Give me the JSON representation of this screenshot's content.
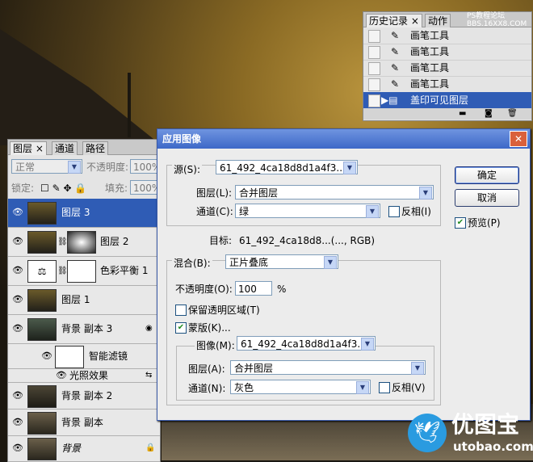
{
  "watermark_top": "PS教程论坛\nBBS.16XX8.COM",
  "history_panel": {
    "tabs": [
      "历史记录",
      "动作"
    ],
    "items": [
      "画笔工具",
      "画笔工具",
      "画笔工具",
      "画笔工具",
      "盖印可见图层"
    ]
  },
  "layers_panel": {
    "tabs": [
      "图层",
      "通道",
      "路径"
    ],
    "blend_mode": "正常",
    "opacity_label": "不透明度:",
    "opacity_value": "100%",
    "lock_label": "锁定:",
    "fill_label": "填充:",
    "fill_value": "100%",
    "layers": [
      {
        "name": "图层 3"
      },
      {
        "name": "图层 2"
      },
      {
        "name": "色彩平衡 1"
      },
      {
        "name": "图层 1"
      },
      {
        "name": "背景 副本 3"
      },
      {
        "name": "智能滤镜"
      },
      {
        "name": "光照效果"
      },
      {
        "name": "背景 副本 2"
      },
      {
        "name": "背景 副本"
      },
      {
        "name": "背景"
      }
    ]
  },
  "dialog": {
    "title": "应用图像",
    "source_label": "源(S):",
    "source_value": "61_492_4ca18d8d1a4f3...",
    "layer_label": "图层(L):",
    "layer_value": "合并图层",
    "channel_label": "通道(C):",
    "channel_value": "绿",
    "invert1_label": "反相(I)",
    "target_label": "目标:",
    "target_value": "61_492_4ca18d8...(..., RGB)",
    "blend_label": "混合(B):",
    "blend_value": "正片叠底",
    "opacity_label": "不透明度(O):",
    "opacity_value": "100",
    "opacity_unit": "%",
    "preserve_label": "保留透明区域(T)",
    "mask_label": "蒙版(K)...",
    "image_label": "图像(M):",
    "image_value": "61_492_4ca18d8d1a4f3...",
    "mask_layer_label": "图层(A):",
    "mask_layer_value": "合并图层",
    "mask_channel_label": "通道(N):",
    "mask_channel_value": "灰色",
    "invert2_label": "反相(V)",
    "ok_label": "确定",
    "cancel_label": "取消",
    "preview_label": "预览(P)"
  },
  "logo": {
    "text": "优图宝",
    "url": "utobao.com"
  }
}
